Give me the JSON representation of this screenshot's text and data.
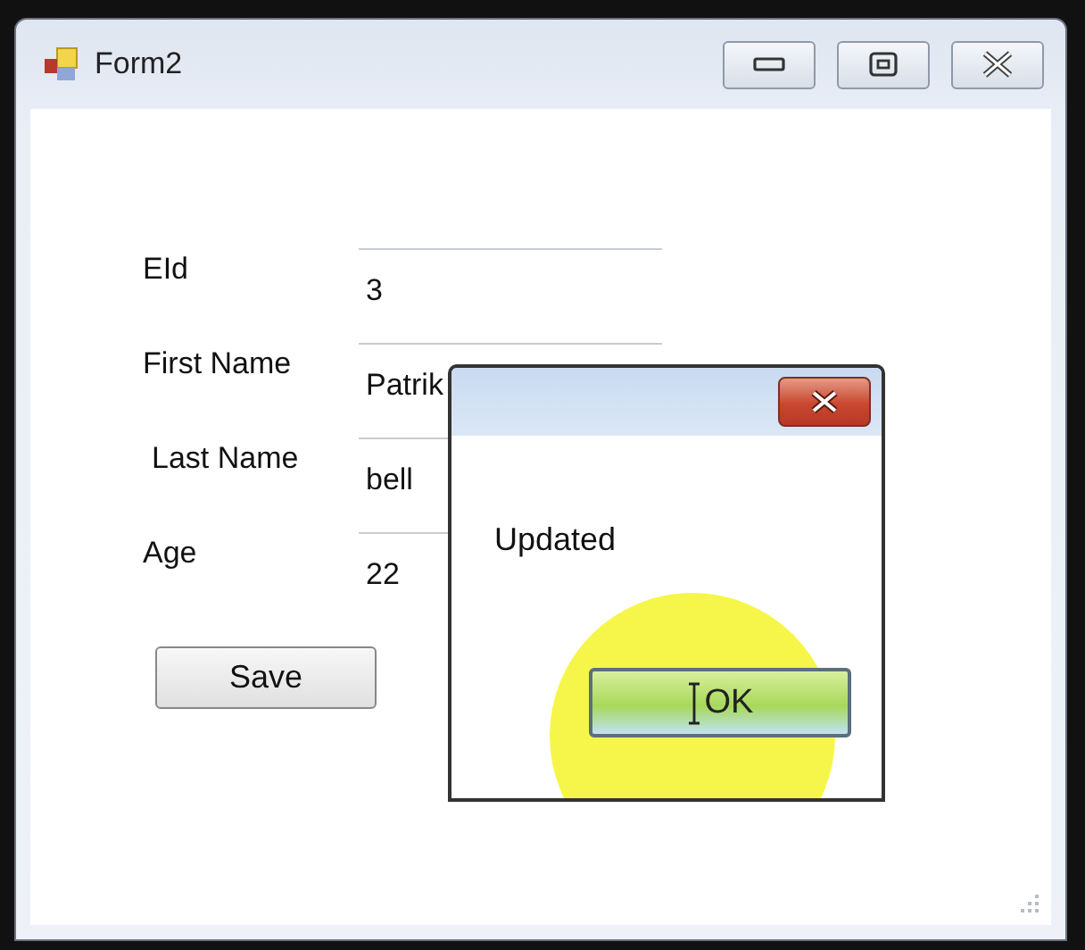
{
  "window": {
    "title": "Form2"
  },
  "form": {
    "fields": [
      {
        "label": "EId",
        "value": "3"
      },
      {
        "label": "First Name",
        "value": "Patrik"
      },
      {
        "label": "Last Name",
        "value": "bell"
      },
      {
        "label": "Age",
        "value": "22"
      }
    ],
    "save_button": "Save"
  },
  "dialog": {
    "message": "Updated",
    "ok_button": "OK"
  }
}
